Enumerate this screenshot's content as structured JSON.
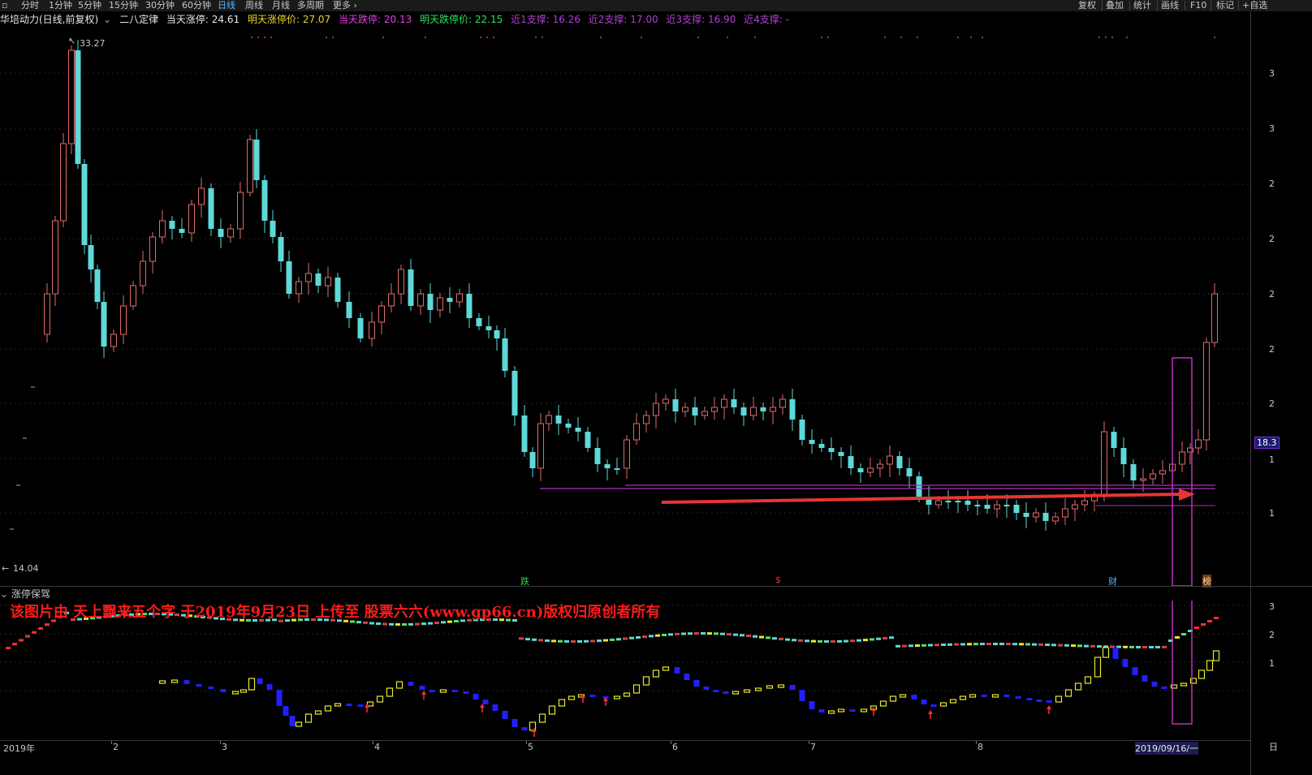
{
  "toolbar": {
    "periods": [
      "分时",
      "1分钟",
      "5分钟",
      "15分钟",
      "30分钟",
      "60分钟",
      "日线",
      "周线",
      "月线",
      "多周期",
      "更多"
    ],
    "active_period": "日线",
    "right_tools": [
      "复权",
      "叠加",
      "统计",
      "画线",
      "F10",
      "标记",
      "+自选"
    ]
  },
  "info": {
    "stock": "华培动力(日线,前复权)",
    "indicator": "二八定律",
    "today_limit_up": "当天涨停: 24.61",
    "tomorrow_limit_up": "明天涨停价: 27.07",
    "today_limit_down": "当天跌停: 20.13",
    "tomorrow_limit_down": "明天跌停价: 22.15",
    "support1": "近1支撑: 16.26",
    "support2": "近2支撑: 17.00",
    "support3": "近3支撑: 16.90",
    "support4": "近4支撑: -"
  },
  "price_labels": {
    "high": "33.27",
    "low": "14.04",
    "current": "18.3"
  },
  "right_axis_ticks": [
    "3",
    "3",
    "2",
    "2",
    "2",
    "2",
    "2",
    "1",
    "1"
  ],
  "indicator_axis_ticks": [
    "3",
    "2",
    "1"
  ],
  "indicator_panel": {
    "title": "涨停保驾"
  },
  "watermark": "该图片由 天上飘来五个字 于2019年9月23日 上传至 股票六六(www.gp66.cn)版权归原创者所有",
  "event_markers": [
    {
      "label": "跌",
      "color": "#2fd14f"
    },
    {
      "label": "$",
      "color": "#e03030"
    },
    {
      "label": "财",
      "color": "#5ab4ff"
    },
    {
      "label": "榜",
      "color": "#e08a2a"
    }
  ],
  "x_axis": {
    "labels": [
      "2019年",
      "2",
      "3",
      "4",
      "5",
      "6",
      "7",
      "8",
      "2019/09/16/一"
    ]
  },
  "colors": {
    "up": "#e06b6b",
    "down": "#5fd8d8",
    "magenta": "#cc33cc",
    "arrow": "#e83535",
    "ind_yellow": "#e8e82a",
    "ind_blue": "#2020ff",
    "ind_red": "#ff3030"
  }
}
